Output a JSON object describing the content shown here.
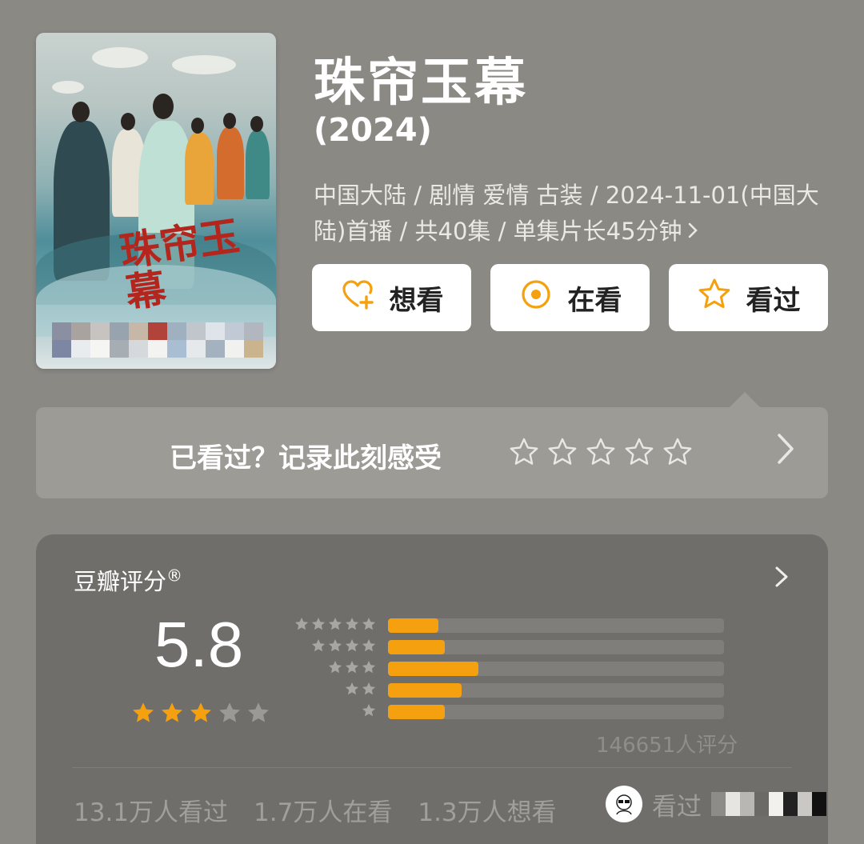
{
  "header": {
    "title": "珠帘玉幕",
    "year": "(2024)",
    "meta_line": "中国大陆 / 剧情 爱情 古装 / 2024-11-01(中国大陆)首播 / 共40集 / 单集片长45分钟"
  },
  "poster": {
    "calligraphy": "珠帘玉幕"
  },
  "actions": {
    "want": "想看",
    "watching": "在看",
    "watched": "看过"
  },
  "rate_prompt": {
    "label": "已看过？记录此刻感受"
  },
  "score": {
    "label": "豆瓣评分",
    "registered_mark": "®",
    "value": "5.8",
    "stars_filled": 3,
    "stars_total": 5,
    "distribution": [
      {
        "stars": 5,
        "fraction": 0.15
      },
      {
        "stars": 4,
        "fraction": 0.17
      },
      {
        "stars": 3,
        "fraction": 0.27
      },
      {
        "stars": 2,
        "fraction": 0.22
      },
      {
        "stars": 1,
        "fraction": 0.17
      }
    ],
    "count_text": "146651人评分"
  },
  "stats": {
    "watched": "13.1万人看过",
    "watching": "1.7万人在看",
    "want": "1.3万人想看",
    "friend_label": "看过"
  },
  "colors": {
    "accent": "#f5a00f",
    "background": "#8a8984",
    "card": "#6f6e6a"
  }
}
